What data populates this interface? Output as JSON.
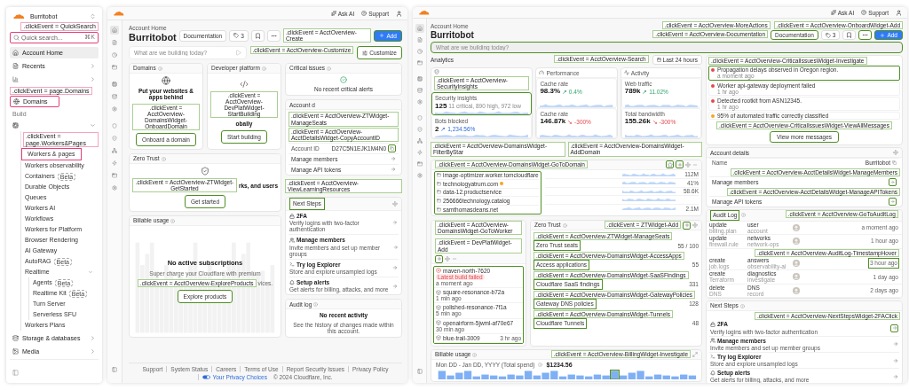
{
  "sidebar": {
    "account": "Burritobot",
    "search": {
      "placeholder": "Quick search...",
      "shortcut": "⌘K",
      "annotation": ".clickEvent = QuickSearch"
    },
    "items": [
      {
        "kind": "link",
        "label": "Account Home",
        "selected": true,
        "expandable": false
      },
      {
        "kind": "link",
        "label": "Recents",
        "selected": false,
        "expandable": true
      },
      {
        "kind": "link",
        "selected": false,
        "expandable": true
      },
      {
        "kind": "link",
        "label": "Domains",
        "selected": false,
        "expandable": false,
        "annotation": ".clickEvent = page.Domains"
      },
      {
        "kind": "section",
        "label": "Build"
      },
      {
        "kind": "group",
        "expanded": true,
        "children": [
          {
            "label": "Workers & pages",
            "selected": false,
            "annotation": ".clickEvent = page.Workers&Pages"
          },
          {
            "label": "Workers observability",
            "selected": false
          },
          {
            "label": "Containers",
            "selected": false,
            "badge": "Beta"
          },
          {
            "label": "Durable Objects",
            "selected": false
          },
          {
            "label": "Queues",
            "selected": false
          },
          {
            "label": "Workers AI",
            "selected": false
          },
          {
            "label": "Workflows",
            "selected": false
          },
          {
            "label": "Workers for Platform",
            "selected": false
          },
          {
            "label": "Browser Rendering",
            "selected": false
          },
          {
            "label": "AI Gateway",
            "selected": false
          },
          {
            "label": "AutoRAG",
            "selected": false,
            "badge": "Beta"
          },
          {
            "label": "Realtime",
            "selected": false,
            "expanded": true,
            "children": [
              {
                "label": "Agents",
                "selected": false,
                "badge": "Beta"
              },
              {
                "label": "Realtime Kit",
                "selected": false,
                "badge": "Beta"
              },
              {
                "label": "Turn Server",
                "selected": false
              },
              {
                "label": "Serverless SFU",
                "selected": false
              }
            ]
          },
          {
            "label": "Workers Plans",
            "selected": false
          }
        ]
      },
      {
        "kind": "link",
        "label": "Storage & databases",
        "selected": false,
        "expandable": true
      },
      {
        "kind": "link",
        "label": "Media",
        "selected": false,
        "expandable": true
      }
    ]
  },
  "overview_empty": {
    "topbar": {
      "links": [
        "Ask AI",
        "Support"
      ]
    },
    "breadcrumb": "Account Home",
    "title": "Burritobot",
    "actions": [
      {
        "kind": "text",
        "label": "Documentation"
      },
      {
        "kind": "tag",
        "label": "3"
      },
      {
        "kind": "icon"
      },
      {
        "kind": "icon"
      },
      {
        "kind": "primary",
        "label": "Add",
        "annotation": ".clickEvent = AcctOverview-Create"
      }
    ],
    "prompt": {
      "placeholder": "What are we building today?"
    },
    "customize": {
      "label": "Customize",
      "annotation": ".clickEvent = AcctOverview-Customize"
    },
    "domains": {
      "title": "Domains",
      "heading": "Put your websites & apps behind",
      "button": "Onboard a domain",
      "annotation": ".clickEvent = AcctOverview-DomainsWidget-OnboardDomain"
    },
    "developer_platform": {
      "title": "Developer platform",
      "heading": "obally",
      "button": "Start building",
      "annotation": ".clickEvent = AcctOverview-DevPlatWidget-StartBuilding"
    },
    "zero_trust": {
      "title": "Zero Trust",
      "heading": "rks, and users",
      "button": "Get started",
      "annotation": ".clickEvent = AcctOverview-ZTWidget-GetStarted"
    },
    "billable_usage": {
      "title": "Billable usage",
      "heading": "No active subscriptions",
      "text": "Super charge your Cloudflare with premium",
      "text_end": "vices.",
      "button": "Explore products",
      "annotation": ".clickEvent = AcctOverview-ExploreProducts"
    },
    "critical_issues": {
      "title": "Critical issues",
      "message": "No recent critical alerts"
    },
    "account_details": {
      "title": "Account d",
      "annotation": ".clickEvent = AcctOverview-ZTWidget-ManageSeats",
      "rows": [
        {
          "kind": "copy",
          "label": "Account ID",
          "value": "D27C5N1EJK1M4N0",
          "annotation": ".clickEvent = AcctOverview-AcctDetailsWidget-CopyAccountID"
        },
        {
          "kind": "link",
          "label": "Manage members"
        },
        {
          "kind": "link",
          "label": "Manage API tokens"
        }
      ]
    },
    "next_steps": {
      "title": "Next Steps",
      "annotation": ".clickEvent = AcctOverview-ViewLearningResources",
      "items": [
        {
          "title": "2FA",
          "text": "Verify logins with two-factor authentication"
        },
        {
          "title": "Manage members",
          "text": "Invite members and set up member groups"
        },
        {
          "title": "Try log Explorer",
          "text": "Store and explore unsampled logs"
        },
        {
          "title": "Setup alerts",
          "text": "Get alerts for billing, attacks, and more"
        }
      ]
    },
    "audit_log": {
      "title": "Audit log",
      "heading": "No recent activity",
      "text": "See the history of changes made within this account."
    },
    "footer": {
      "links": [
        "Support",
        "System Status",
        "Careers",
        "Terms of Use",
        "Report Security Issues",
        "Privacy Policy"
      ],
      "privacy": "Your Privacy Choices",
      "copyright": "© 2024 Cloudflare, Inc."
    }
  },
  "overview_full": {
    "topbar": {
      "links": [
        "Ask AI",
        "Support"
      ]
    },
    "breadcrumb": "Account Home",
    "title": "Burritobot",
    "actions_annotation": ".clickEvent = AcctOverview-OnboardWidget-Add",
    "actions": [
      {
        "kind": "text",
        "label": "Documentation",
        "annotation": ".clickEvent = AcctOverview-Documentation"
      },
      {
        "kind": "tag",
        "label": "3"
      },
      {
        "kind": "icon"
      },
      {
        "kind": "icon",
        "highlighted": true
      },
      {
        "kind": "primary",
        "label": "Add",
        "highlighted": true
      }
    ],
    "more_annotation": ".clickEvent = AcctOverview-MoreActions",
    "prompt": {
      "placeholder": "What are we building today?",
      "annotation": ".clickEvent = AcctOverview-Search"
    },
    "analytics": {
      "title": "Analytics",
      "range": "Last 24 hours",
      "groups": [
        {
          "annotation": ".clickEvent = AcctOverview-SecurityInsights",
          "metrics": [
            {
              "label": "Security insights",
              "value": "125",
              "note": "11 critical, 890 high, 972 low",
              "kind": "plain",
              "highlighted": true
            },
            {
              "label": "Bots blocked",
              "value": "2",
              "note": "↗ 1,234.56%",
              "kind": "info",
              "highlighted": false
            }
          ]
        },
        {
          "title": "Performance",
          "metrics": [
            {
              "label": "Cache rate",
              "value": "98.3%",
              "note": "↗ 0.4%",
              "kind": "up",
              "highlighted": false
            },
            {
              "label": "Cache rate",
              "value": "146.87k",
              "note": "↘ -300%",
              "kind": "down",
              "highlighted": false
            }
          ]
        },
        {
          "title": "Activity",
          "metrics": [
            {
              "label": "Web traffic",
              "value": "789k",
              "note": "↗ 11.02%",
              "kind": "up",
              "highlighted": false
            },
            {
              "label": "Total bandwidth",
              "value": "155.26k",
              "note": "↘ -300%",
              "kind": "down",
              "highlighted": false
            }
          ]
        }
      ]
    },
    "domains": {
      "annotation": ".clickEvent = AcctOverview-DomainsWidget-GoToDomain",
      "filter_annotation": ".clickEvent = AcctOverview-DomainsWidget-FilterByStar",
      "add_annotation": ".clickEvent = AcctOverview-DomainsWidget-AddDomain",
      "rows": [
        {
          "name": "image-optimizer.worker.tomcloudflare",
          "value": "112M",
          "warning": false
        },
        {
          "name": "technologyatrum.com",
          "value": "41%",
          "warning": true
        },
        {
          "name": "data-12.productservice",
          "value": "58.6K",
          "warning": false
        },
        {
          "name": "256666technology.catalog",
          "warning": false
        },
        {
          "name": "samthomasdeans.net",
          "value": "2.1M",
          "warning": false
        }
      ]
    },
    "developer_platform": {
      "annotation": ".clickEvent = AcctOverview-DomainsWidget-GoToWorker",
      "add_annotation": ".clickEvent = DevPlatWidget-Add",
      "rows": [
        {
          "name": "maven-north-7620",
          "failed": true,
          "badge": "Latest build failed",
          "time": "a moment ago"
        },
        {
          "name": "square-resonance-b72a",
          "failed": false,
          "time": "1 min ago"
        },
        {
          "name": "polished-resonance-7f1a",
          "failed": false,
          "time": "5 min ago"
        },
        {
          "name": "openairform-5jwml-af70e67",
          "failed": false,
          "time": "30 min ago"
        },
        {
          "name": "blue-trail-3009",
          "failed": false,
          "time": "3 hr ago"
        }
      ]
    },
    "zero_trust": {
      "title": "Zero Trust",
      "add_annotation": ".clickEvent = ZTWidget-Add",
      "rows": [
        {
          "label": "Zero Trust seats",
          "count": "55 / 100",
          "annotation": ".clickEvent = AcctOverview-ZTWidget-ManageSeats"
        },
        {
          "label": "Access applications",
          "count": "55",
          "annotation": ".clickEvent = AcctOverview-DomainsWidget-AccessApps"
        },
        {
          "label": "Cloudflare SaaS findings",
          "count": "331",
          "annotation": ".clickEvent = AcctOverview-DomainsWidget-SaaSFindings"
        },
        {
          "label": "Gateway DNS policies",
          "count": "128",
          "annotation": ".clickEvent = AcctOverview-DomainsWidget-GatewayPolicies"
        },
        {
          "label": "Cloudflare Tunnels",
          "count": "48",
          "annotation": ".clickEvent = AcctOverview-DomainsWidget-Tunnels"
        }
      ]
    },
    "billable_usage": {
      "title": "Billable usage",
      "period": "Mon DD - Jan DD, YYYY (Total spend)",
      "total": "$1234.56",
      "chart_annotation": ".clickEvent = AcctOverview-BillingWidget-Investigate"
    },
    "critical_issues": {
      "annotation": ".clickEvent = AcctOverview-CriticalIssuesWidget-Investigate",
      "items": [
        {
          "title": "Propagation delays observed in Oregon region.",
          "time": "a moment ago",
          "color": "#e5484d",
          "highlighted": true
        },
        {
          "title": "Worker api-gateway deployment failed",
          "time": "1 hr ago",
          "color": "#e5484d",
          "highlighted": false
        },
        {
          "title": "Detected rootkit from ASN12345.",
          "time": "1 hr ago",
          "color": "#e5484d",
          "highlighted": false
        },
        {
          "title": "95% of automated traffic correctly classified",
          "color": "#f5a623",
          "highlighted": false
        }
      ],
      "button": "View more messages",
      "button_annotation": ".clickEvent = AcctOverview-CriticalIssuesWidget-ViewAllMessages"
    },
    "account_details": {
      "title": "Account details",
      "rows": [
        {
          "kind": "copy",
          "label": "Name",
          "value": "Burritobot"
        },
        {
          "kind": "link",
          "label": "Manage members",
          "annotation": ".clickEvent = AcctOverview-AcctDetailsWidget-ManageMembers"
        },
        {
          "kind": "link",
          "label": "Manage API tokens",
          "annotation": ".clickEvent = AcctOverview-AcctDetailsWidget-ManageAPITokens"
        }
      ]
    },
    "audit_log": {
      "title": "Audit Log",
      "annotation": ".clickEvent = AcctOverview-GoToAuditLog",
      "rows": [
        {
          "action": "update",
          "target": "billing.plan",
          "user": "user",
          "detail": "account",
          "time": "a moment ago"
        },
        {
          "action": "update",
          "target": "firewall.rule",
          "user": "networks",
          "detail": "network-ops",
          "time": "1 hour ago"
        },
        {
          "action": "create",
          "target": "job.logs",
          "user": "answers",
          "detail": "observability-ai",
          "time": "3 hour ago",
          "annotation": ".clickEvent = AcctOverview-AuditLog-TimestampHover"
        },
        {
          "action": "create",
          "target": "Terraform",
          "user": "diagnostics",
          "detail": "investigate",
          "time": "1 day ago"
        },
        {
          "action": "delete",
          "target": "DNS",
          "user": "DNS",
          "detail": "record",
          "time": "2 days ago"
        }
      ]
    },
    "next_steps": {
      "title": "Next Steps",
      "annotation": ".clickEvent = AcctOverview-NextStepsWidget-2FAClick",
      "items": [
        {
          "title": "2FA",
          "text": "Verify logins with two-factor authentication"
        },
        {
          "title": "Manage members",
          "text": "Invite members and set up member groups"
        },
        {
          "title": "Try log Explorer",
          "text": "Store and explore unsampled logs"
        },
        {
          "title": "Setup alerts",
          "text": "Get alerts for billing, attacks, and more"
        }
      ]
    }
  }
}
